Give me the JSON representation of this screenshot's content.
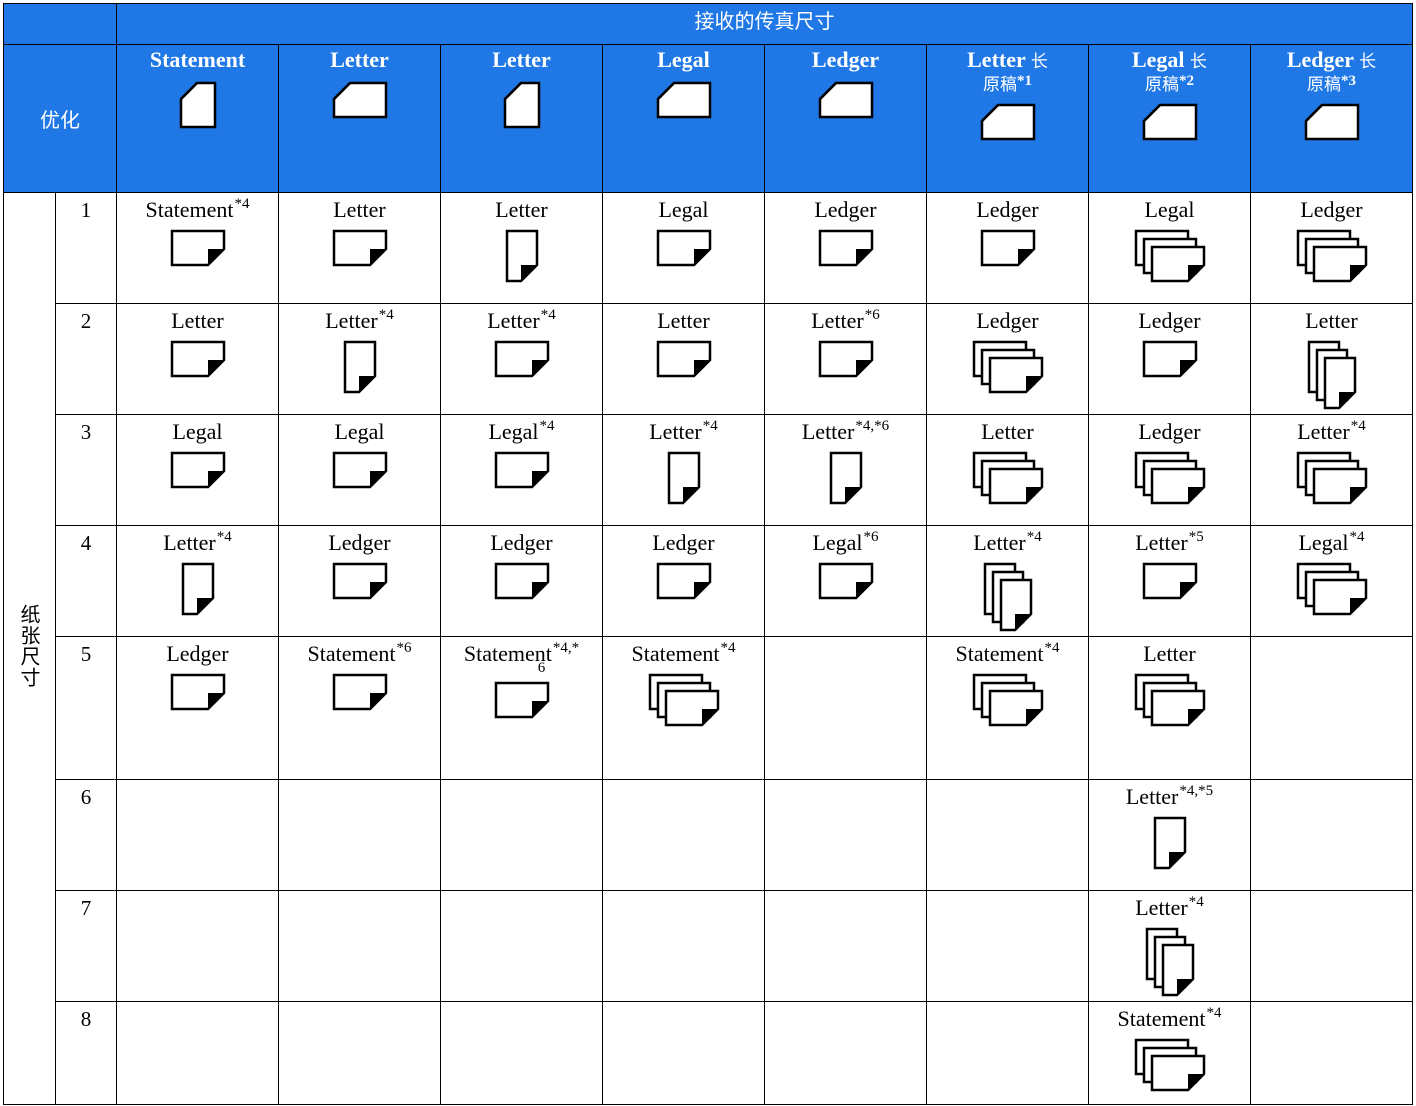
{
  "title": "接收的传真尺寸",
  "priority_label": "优化",
  "paper_size_label": "纸张尺寸",
  "columns": [
    {
      "name": "Statement",
      "suffix": "",
      "sub": "",
      "note": "",
      "orientation": "portrait"
    },
    {
      "name": "Letter",
      "suffix": "",
      "sub": "",
      "note": "",
      "orientation": "landscape"
    },
    {
      "name": "Letter",
      "suffix": "",
      "sub": "",
      "note": "",
      "orientation": "portrait"
    },
    {
      "name": "Legal",
      "suffix": "",
      "sub": "",
      "note": "",
      "orientation": "landscape"
    },
    {
      "name": "Ledger",
      "suffix": "",
      "sub": "",
      "note": "",
      "orientation": "landscape"
    },
    {
      "name": "Letter",
      "suffix": "长",
      "sub": "原稿",
      "note": "*1",
      "orientation": "landscape"
    },
    {
      "name": "Legal",
      "suffix": "长",
      "sub": "原稿",
      "note": "*2",
      "orientation": "landscape"
    },
    {
      "name": "Ledger",
      "suffix": "长",
      "sub": "原稿",
      "note": "*3",
      "orientation": "landscape"
    }
  ],
  "row_numbers": [
    "1",
    "2",
    "3",
    "4",
    "5",
    "6",
    "7",
    "8"
  ],
  "cells": [
    [
      {
        "text": "Statement",
        "note": "*4",
        "icon": "landscape-single"
      },
      {
        "text": "Letter",
        "note": "",
        "icon": "landscape-single"
      },
      {
        "text": "Letter",
        "note": "",
        "icon": "portrait-single"
      },
      {
        "text": "Legal",
        "note": "",
        "icon": "landscape-single"
      },
      {
        "text": "Ledger",
        "note": "",
        "icon": "landscape-single"
      },
      {
        "text": "Ledger",
        "note": "",
        "icon": "landscape-single"
      },
      {
        "text": "Legal",
        "note": "",
        "icon": "landscape-multi"
      },
      {
        "text": "Ledger",
        "note": "",
        "icon": "landscape-multi"
      }
    ],
    [
      {
        "text": "Letter",
        "note": "",
        "icon": "landscape-single"
      },
      {
        "text": "Letter",
        "note": "*4",
        "icon": "portrait-single"
      },
      {
        "text": "Letter",
        "note": "*4",
        "icon": "landscape-single"
      },
      {
        "text": "Letter",
        "note": "",
        "icon": "landscape-single"
      },
      {
        "text": "Letter",
        "note": "*6",
        "icon": "landscape-single"
      },
      {
        "text": "Ledger",
        "note": "",
        "icon": "landscape-multi"
      },
      {
        "text": "Ledger",
        "note": "",
        "icon": "landscape-single"
      },
      {
        "text": "Letter",
        "note": "",
        "icon": "portrait-multi"
      }
    ],
    [
      {
        "text": "Legal",
        "note": "",
        "icon": "landscape-single"
      },
      {
        "text": "Legal",
        "note": "",
        "icon": "landscape-single"
      },
      {
        "text": "Legal",
        "note": "*4",
        "icon": "landscape-single"
      },
      {
        "text": "Letter",
        "note": "*4",
        "icon": "portrait-single"
      },
      {
        "text": "Letter",
        "note": "*4,*6",
        "icon": "portrait-single"
      },
      {
        "text": "Letter",
        "note": "",
        "icon": "landscape-multi"
      },
      {
        "text": "Ledger",
        "note": "",
        "icon": "landscape-multi"
      },
      {
        "text": "Letter",
        "note": "*4",
        "icon": "landscape-multi"
      }
    ],
    [
      {
        "text": "Letter",
        "note": "*4",
        "icon": "portrait-single"
      },
      {
        "text": "Ledger",
        "note": "",
        "icon": "landscape-single"
      },
      {
        "text": "Ledger",
        "note": "",
        "icon": "landscape-single"
      },
      {
        "text": "Ledger",
        "note": "",
        "icon": "landscape-single"
      },
      {
        "text": "Legal",
        "note": "*6",
        "icon": "landscape-single"
      },
      {
        "text": "Letter",
        "note": "*4",
        "icon": "portrait-multi"
      },
      {
        "text": "Letter",
        "note": "*5",
        "icon": "landscape-single"
      },
      {
        "text": "Legal",
        "note": "*4",
        "icon": "landscape-multi"
      }
    ],
    [
      {
        "text": "Ledger",
        "note": "",
        "icon": "landscape-single"
      },
      {
        "text": "Statement",
        "note": "*6",
        "icon": "landscape-single"
      },
      {
        "text": "Statement",
        "note": "*4,*",
        "note2": "6",
        "icon": "landscape-single"
      },
      {
        "text": "Statement",
        "note": "*4",
        "icon": "landscape-multi"
      },
      {
        "text": "",
        "note": "",
        "icon": ""
      },
      {
        "text": "Statement",
        "note": "*4",
        "icon": "landscape-multi"
      },
      {
        "text": "Letter",
        "note": "",
        "icon": "landscape-multi"
      },
      {
        "text": "",
        "note": "",
        "icon": ""
      }
    ],
    [
      {
        "text": "",
        "note": "",
        "icon": ""
      },
      {
        "text": "",
        "note": "",
        "icon": ""
      },
      {
        "text": "",
        "note": "",
        "icon": ""
      },
      {
        "text": "",
        "note": "",
        "icon": ""
      },
      {
        "text": "",
        "note": "",
        "icon": ""
      },
      {
        "text": "",
        "note": "",
        "icon": ""
      },
      {
        "text": "Letter",
        "note": "*4,*5",
        "icon": "portrait-single"
      },
      {
        "text": "",
        "note": "",
        "icon": ""
      }
    ],
    [
      {
        "text": "",
        "note": "",
        "icon": ""
      },
      {
        "text": "",
        "note": "",
        "icon": ""
      },
      {
        "text": "",
        "note": "",
        "icon": ""
      },
      {
        "text": "",
        "note": "",
        "icon": ""
      },
      {
        "text": "",
        "note": "",
        "icon": ""
      },
      {
        "text": "",
        "note": "",
        "icon": ""
      },
      {
        "text": "Letter",
        "note": "*4",
        "icon": "portrait-multi"
      },
      {
        "text": "",
        "note": "",
        "icon": ""
      }
    ],
    [
      {
        "text": "",
        "note": "",
        "icon": ""
      },
      {
        "text": "",
        "note": "",
        "icon": ""
      },
      {
        "text": "",
        "note": "",
        "icon": ""
      },
      {
        "text": "",
        "note": "",
        "icon": ""
      },
      {
        "text": "",
        "note": "",
        "icon": ""
      },
      {
        "text": "",
        "note": "",
        "icon": ""
      },
      {
        "text": "Statement",
        "note": "*4",
        "icon": "landscape-multi"
      },
      {
        "text": "",
        "note": "",
        "icon": ""
      }
    ]
  ],
  "colors": {
    "header_bg": "#1f78e5",
    "header_text": "#ffffff",
    "grid": "#000000"
  }
}
